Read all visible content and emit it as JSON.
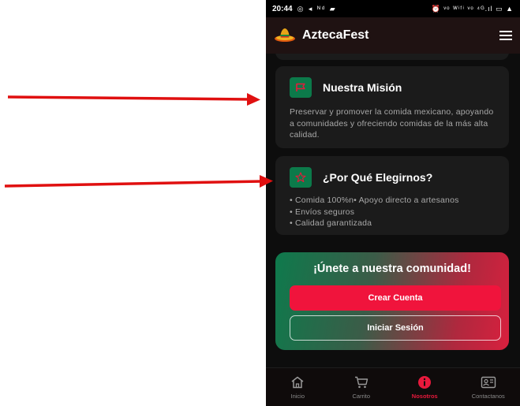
{
  "status": {
    "time": "20:44",
    "left_icons": "◎ ◂ ᴺᵈ ▰",
    "right_icons": "⏰ ᵛᵒ ᵂⁱᶠⁱ ᵛᵒ ⁴ᴳ.ıl ▭ ▲"
  },
  "app": {
    "title": "AztecaFest",
    "menu_icon": "hamburger-icon"
  },
  "mission": {
    "icon": "flag-icon",
    "title": "Nuestra Misión",
    "text": "Preservar y promover la comida mexicano, apoyando a comunidades y ofreciendo comidas de la más alta calidad."
  },
  "why": {
    "icon": "star-icon",
    "title": "¿Por Qué Elegirnos?",
    "items": [
      "• Comida 100%n• Apoyo directo a artesanos",
      "• Envíos seguros",
      "• Calidad garantizada"
    ]
  },
  "cta": {
    "title": "¡Únete a nuestra comunidad!",
    "create_label": "Crear Cuenta",
    "login_label": "Iniciar Sesión"
  },
  "nav": {
    "items": [
      {
        "label": "Inicio",
        "icon": "home-icon"
      },
      {
        "label": "Carrito",
        "icon": "cart-icon"
      },
      {
        "label": "Nosotros",
        "icon": "info-icon"
      },
      {
        "label": "Contactanos",
        "icon": "contact-card-icon"
      }
    ],
    "active_index": 2
  },
  "colors": {
    "accent_red": "#f0143c",
    "accent_green": "#0c7a4a",
    "annotation_arrow": "#e01010"
  }
}
